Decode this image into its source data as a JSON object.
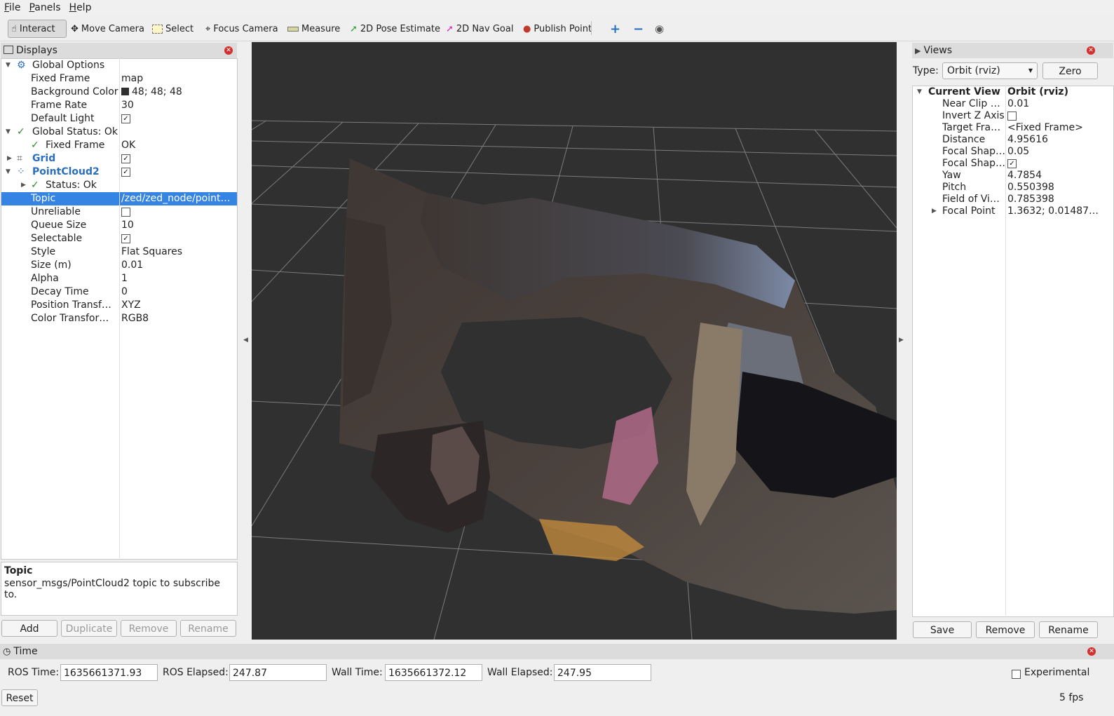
{
  "menu": [
    "File",
    "Panels",
    "Help"
  ],
  "toolbar": {
    "interact": "Interact",
    "move_camera": "Move Camera",
    "select": "Select",
    "focus_camera": "Focus Camera",
    "measure": "Measure",
    "pose_estimate": "2D Pose Estimate",
    "nav_goal": "2D Nav Goal",
    "publish_point": "Publish Point"
  },
  "displays": {
    "title": "Displays",
    "rows": {
      "global_options": "Global Options",
      "fixed_frame": {
        "label": "Fixed Frame",
        "value": "map"
      },
      "background_color": {
        "label": "Background Color",
        "value": "48; 48; 48"
      },
      "frame_rate": {
        "label": "Frame Rate",
        "value": "30"
      },
      "default_light": {
        "label": "Default Light"
      },
      "global_status": "Global Status: Ok",
      "gs_fixed_frame": {
        "label": "Fixed Frame",
        "value": "OK"
      },
      "grid": "Grid",
      "pointcloud2": "PointCloud2",
      "status_ok": "Status: Ok",
      "topic": {
        "label": "Topic",
        "value": "/zed/zed_node/point…"
      },
      "unreliable": {
        "label": "Unreliable"
      },
      "queue_size": {
        "label": "Queue Size",
        "value": "10"
      },
      "selectable": {
        "label": "Selectable"
      },
      "style": {
        "label": "Style",
        "value": "Flat Squares"
      },
      "size": {
        "label": "Size (m)",
        "value": "0.01"
      },
      "alpha": {
        "label": "Alpha",
        "value": "1"
      },
      "decay_time": {
        "label": "Decay Time",
        "value": "0"
      },
      "position_transformer": {
        "label": "Position Transf…",
        "value": "XYZ"
      },
      "color_transformer": {
        "label": "Color Transfor…",
        "value": "RGB8"
      }
    },
    "description": {
      "title": "Topic",
      "text": "sensor_msgs/PointCloud2 topic to subscribe to."
    },
    "buttons": {
      "add": "Add",
      "duplicate": "Duplicate",
      "remove": "Remove",
      "rename": "Rename"
    }
  },
  "views": {
    "title": "Views",
    "type_label": "Type:",
    "type_value": "Orbit (rviz)",
    "zero": "Zero",
    "current_view": {
      "label": "Current View",
      "value": "Orbit (rviz)"
    },
    "props": [
      {
        "label": "Near Clip …",
        "value": "0.01"
      },
      {
        "label": "Invert Z Axis",
        "value": ""
      },
      {
        "label": "Target Fra…",
        "value": "<Fixed Frame>"
      },
      {
        "label": "Distance",
        "value": "4.95616"
      },
      {
        "label": "Focal Shap…",
        "value": "0.05"
      },
      {
        "label": "Focal Shap…",
        "value": ""
      },
      {
        "label": "Yaw",
        "value": "4.7854"
      },
      {
        "label": "Pitch",
        "value": "0.550398"
      },
      {
        "label": "Field of Vi…",
        "value": "0.785398"
      },
      {
        "label": "Focal Point",
        "value": "1.3632; 0.01487…"
      }
    ],
    "buttons": {
      "save": "Save",
      "remove": "Remove",
      "rename": "Rename"
    }
  },
  "time": {
    "title": "Time",
    "ros_time_label": "ROS Time:",
    "ros_time": "1635661371.93",
    "ros_elapsed_label": "ROS Elapsed:",
    "ros_elapsed": "247.87",
    "wall_time_label": "Wall Time:",
    "wall_time": "1635661372.12",
    "wall_elapsed_label": "Wall Elapsed:",
    "wall_elapsed": "247.95",
    "experimental": "Experimental",
    "reset": "Reset",
    "fps": "5 fps"
  },
  "colors": {
    "viewport_bg": "#303030",
    "selection": "#3584e4",
    "background_swatch": "#303030"
  }
}
